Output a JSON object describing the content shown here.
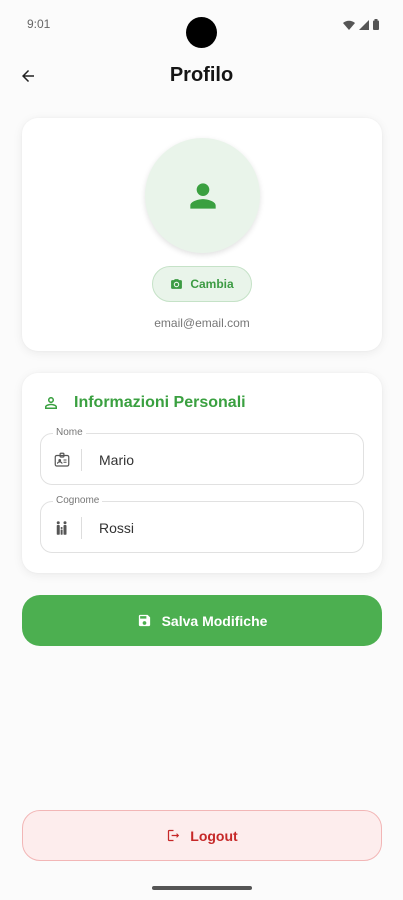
{
  "status_bar": {
    "time": "9:01",
    "icons": [
      "wifi-icon",
      "signal-icon",
      "battery-icon"
    ]
  },
  "app_bar": {
    "title": "Profilo",
    "back_icon": "arrow-left-icon"
  },
  "profile": {
    "avatar_icon": "person-icon",
    "change_label": "Cambia",
    "change_icon": "camera-icon",
    "email": "email@email.com"
  },
  "personal_info": {
    "title": "Informazioni Personali",
    "icon": "person-outline-icon",
    "fields": [
      {
        "label": "Nome",
        "value": "Mario",
        "icon": "badge-icon"
      },
      {
        "label": "Cognome",
        "value": "Rossi",
        "icon": "family-icon"
      }
    ]
  },
  "actions": {
    "save_label": "Salva Modifiche",
    "save_icon": "save-icon",
    "logout_label": "Logout",
    "logout_icon": "logout-icon"
  },
  "colors": {
    "primary": "#4caf50",
    "primary_text": "#3aa040",
    "primary_light": "#e9f4ea",
    "danger": "#c62828",
    "danger_light": "#fdeded"
  }
}
